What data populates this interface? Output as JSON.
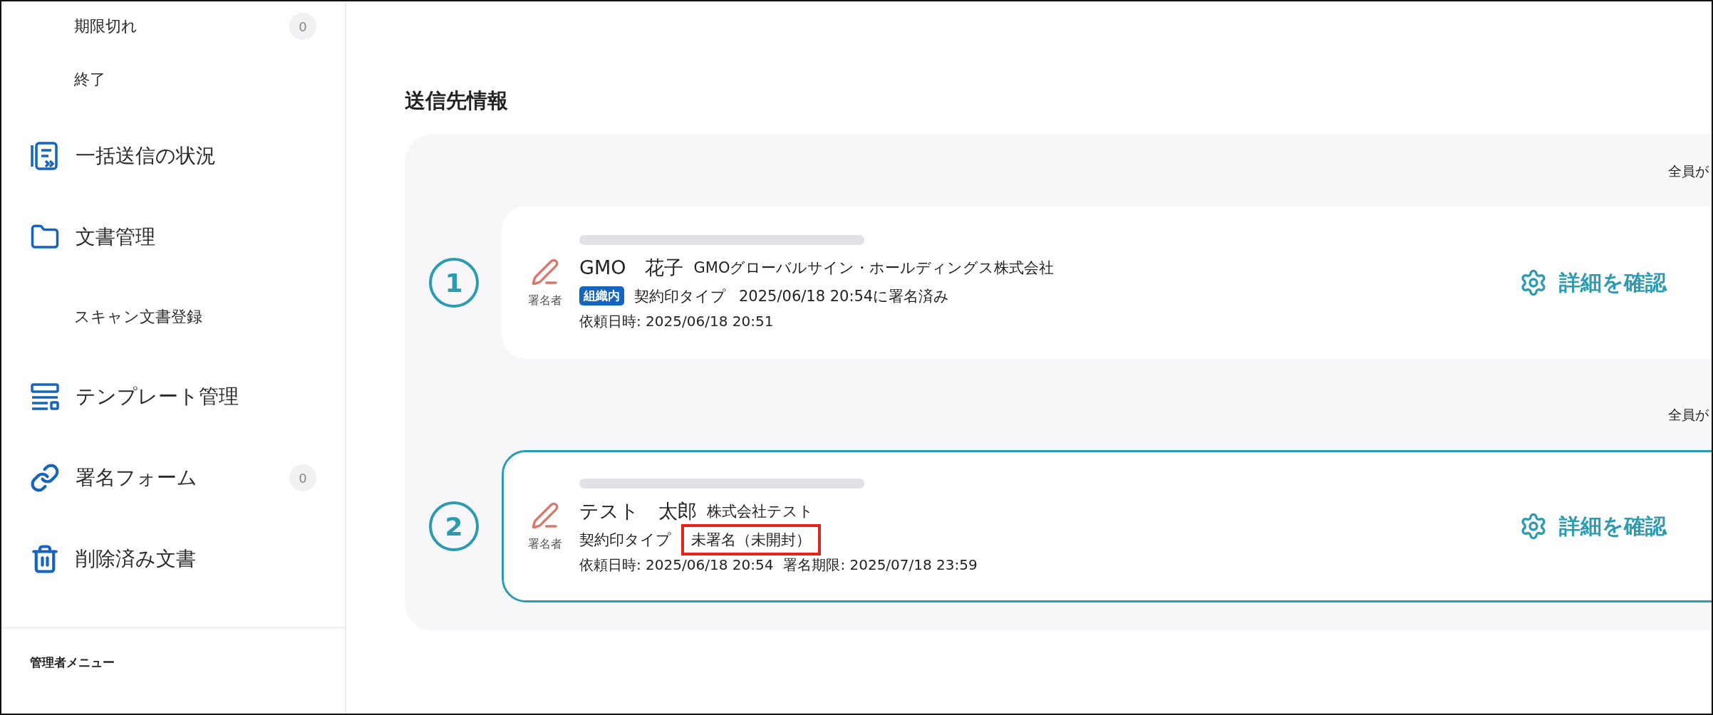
{
  "sidebar": {
    "items": [
      {
        "kind": "sub",
        "label": "期限切れ",
        "count": "0"
      },
      {
        "kind": "sub",
        "label": "終了"
      },
      {
        "kind": "bulk",
        "label": "一括送信の状況"
      },
      {
        "kind": "folder",
        "label": "文書管理"
      },
      {
        "kind": "sub",
        "label": "スキャン文書登録"
      },
      {
        "kind": "template",
        "label": "テンプレート管理"
      },
      {
        "kind": "link",
        "label": "署名フォーム",
        "count": "0"
      },
      {
        "kind": "trash",
        "label": "削除済み文書"
      }
    ],
    "admin_heading": "管理者メニュー"
  },
  "recipients": {
    "title": "送信先情報",
    "groups": [
      {
        "note": "全員が",
        "number": "1",
        "selected": false,
        "role": "署名者",
        "name": "GMO　花子",
        "company": "GMOグローバルサイン・ホールディングス株式会社",
        "org_badge": "組織内",
        "type": "契約印タイプ",
        "status": "2025/06/18 20:54に署名済み",
        "status_highlighted": false,
        "requested": "依頼日時: 2025/06/18 20:51",
        "action": "詳細を確認"
      },
      {
        "note": "全員が",
        "number": "2",
        "selected": true,
        "role": "署名者",
        "name": "テスト　太郎",
        "company": "株式会社テスト",
        "type": "契約印タイプ",
        "status": "未署名（未開封）",
        "status_highlighted": true,
        "requested": "依頼日時: 2025/06/18 20:54",
        "deadline": "署名期限: 2025/07/18 23:59",
        "action": "詳細を確認"
      }
    ]
  }
}
